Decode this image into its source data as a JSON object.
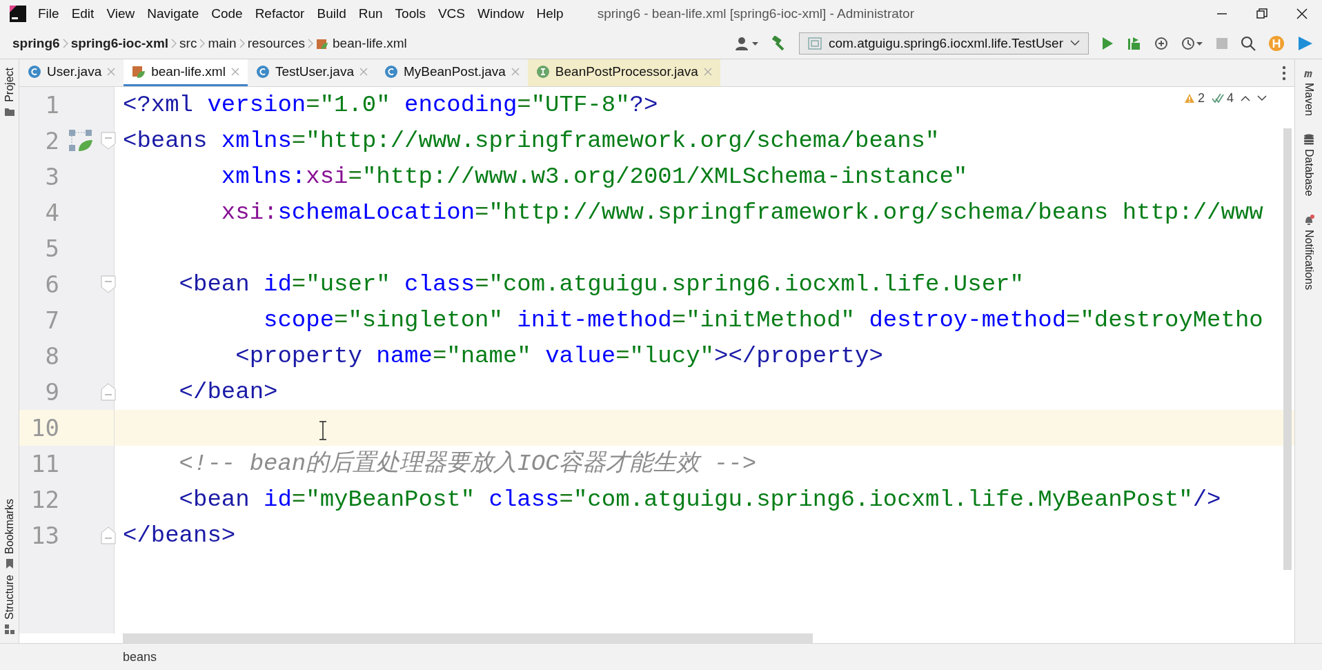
{
  "window": {
    "title": "spring6 - bean-life.xml [spring6-ioc-xml] - Administrator"
  },
  "menu": [
    "File",
    "Edit",
    "View",
    "Navigate",
    "Code",
    "Refactor",
    "Build",
    "Run",
    "Tools",
    "VCS",
    "Window",
    "Help"
  ],
  "breadcrumbs": [
    "spring6",
    "spring6-ioc-xml",
    "src",
    "main",
    "resources",
    "bean-life.xml"
  ],
  "run_configuration": "com.atguigu.spring6.iocxml.life.TestUser",
  "tabs": [
    {
      "label": "User.java",
      "kind": "class",
      "selected": false,
      "library": false
    },
    {
      "label": "bean-life.xml",
      "kind": "xml",
      "selected": true,
      "library": false
    },
    {
      "label": "TestUser.java",
      "kind": "class",
      "selected": false,
      "library": false
    },
    {
      "label": "MyBeanPost.java",
      "kind": "class",
      "selected": false,
      "library": false
    },
    {
      "label": "BeanPostProcessor.java",
      "kind": "interface",
      "selected": false,
      "library": true
    }
  ],
  "left_tools": [
    "Project",
    "Bookmarks",
    "Structure"
  ],
  "right_tools": [
    "Maven",
    "Database",
    "Notifications"
  ],
  "inspections": {
    "warnings": "2",
    "weak_warnings": "4"
  },
  "editor": {
    "lines": [
      {
        "number": "1",
        "current": false,
        "tokens": [
          {
            "kind": "tag",
            "text": "<?xml "
          },
          {
            "kind": "attr",
            "text": "version"
          },
          {
            "kind": "punct",
            "text": "="
          },
          {
            "kind": "value",
            "text": "\"1.0\" "
          },
          {
            "kind": "attr",
            "text": "encoding"
          },
          {
            "kind": "punct",
            "text": "="
          },
          {
            "kind": "value",
            "text": "\"UTF-8\""
          },
          {
            "kind": "tag",
            "text": "?>"
          }
        ]
      },
      {
        "number": "2",
        "current": false,
        "fold_start": true,
        "bean_icon": true,
        "tokens": [
          {
            "kind": "tag",
            "text": "<beans "
          },
          {
            "kind": "attr",
            "text": "xmlns"
          },
          {
            "kind": "punct",
            "text": "="
          },
          {
            "kind": "value",
            "text": "\"http://www.springframework.org/schema/beans\""
          }
        ]
      },
      {
        "number": "3",
        "current": false,
        "tokens": [
          {
            "kind": "attr",
            "text": "       xmlns:"
          },
          {
            "kind": "ns",
            "text": "xsi"
          },
          {
            "kind": "punct",
            "text": "="
          },
          {
            "kind": "value",
            "text": "\"http://www.w3.org/2001/XMLSchema-instance\""
          }
        ]
      },
      {
        "number": "4",
        "current": false,
        "tokens": [
          {
            "kind": "ns",
            "text": "       xsi:"
          },
          {
            "kind": "attr",
            "text": "schemaLocation"
          },
          {
            "kind": "punct",
            "text": "="
          },
          {
            "kind": "value",
            "text": "\"http://www.springframework.org/schema/beans http://www"
          }
        ]
      },
      {
        "number": "5",
        "current": false
      },
      {
        "number": "6",
        "current": false,
        "fold_start": true,
        "tokens": [
          {
            "kind": "tag",
            "text": "    <bean "
          },
          {
            "kind": "attr",
            "text": "id"
          },
          {
            "kind": "punct",
            "text": "="
          },
          {
            "kind": "value",
            "text": "\"user\" "
          },
          {
            "kind": "attr",
            "text": "class"
          },
          {
            "kind": "punct",
            "text": "="
          },
          {
            "kind": "value",
            "text": "\"com.atguigu.spring6.iocxml.life.User\""
          }
        ]
      },
      {
        "number": "7",
        "current": false,
        "tokens": [
          {
            "kind": "attr",
            "text": "          scope"
          },
          {
            "kind": "punct",
            "text": "="
          },
          {
            "kind": "value",
            "text": "\"singleton\" "
          },
          {
            "kind": "attr",
            "text": "init-method"
          },
          {
            "kind": "punct",
            "text": "="
          },
          {
            "kind": "value",
            "text": "\"initMethod\" "
          },
          {
            "kind": "attr",
            "text": "destroy-method"
          },
          {
            "kind": "punct",
            "text": "="
          },
          {
            "kind": "value",
            "text": "\"destroyMetho"
          }
        ]
      },
      {
        "number": "8",
        "current": false,
        "tokens": [
          {
            "kind": "tag",
            "text": "        <property "
          },
          {
            "kind": "attr",
            "text": "name"
          },
          {
            "kind": "punct",
            "text": "="
          },
          {
            "kind": "value",
            "text": "\"name\" "
          },
          {
            "kind": "attr",
            "text": "value"
          },
          {
            "kind": "punct",
            "text": "="
          },
          {
            "kind": "value",
            "text": "\"lucy\""
          },
          {
            "kind": "tag",
            "text": "></property>"
          }
        ]
      },
      {
        "number": "9",
        "current": false,
        "fold_end": true,
        "tokens": [
          {
            "kind": "tag",
            "text": "    </bean>"
          }
        ]
      },
      {
        "number": "10",
        "current": true
      },
      {
        "number": "11",
        "current": false,
        "tokens": [
          {
            "kind": "comment",
            "text": "    <!-- bean的后置处理器要放入IOC容器才能生效 -->"
          }
        ]
      },
      {
        "number": "12",
        "current": false,
        "tokens": [
          {
            "kind": "tag",
            "text": "    <bean "
          },
          {
            "kind": "attr",
            "text": "id"
          },
          {
            "kind": "punct",
            "text": "="
          },
          {
            "kind": "value",
            "text": "\"myBeanPost\" "
          },
          {
            "kind": "attr",
            "text": "class"
          },
          {
            "kind": "punct",
            "text": "="
          },
          {
            "kind": "value",
            "text": "\"com.atguigu.spring6.iocxml.life.MyBeanPost\""
          },
          {
            "kind": "tag",
            "text": "/>"
          }
        ]
      },
      {
        "number": "13",
        "current": false,
        "fold_end": true,
        "tokens": [
          {
            "kind": "tag",
            "text": "</beans>"
          }
        ]
      }
    ]
  },
  "status_bar": {
    "breadcrumb": "beans"
  }
}
